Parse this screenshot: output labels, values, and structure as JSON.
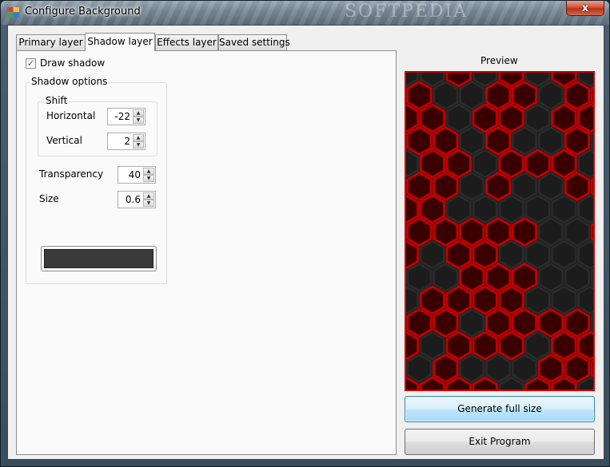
{
  "window": {
    "title": "Configure Background",
    "watermark": "SOFTPEDIA",
    "close_glyph": "x",
    "app_icon": "app-icon-squares"
  },
  "tabs": [
    {
      "label": "Primary layer",
      "active": false
    },
    {
      "label": "Shadow layer",
      "active": true
    },
    {
      "label": "Effects layer",
      "active": false
    },
    {
      "label": "Saved settings",
      "active": false
    }
  ],
  "shadow": {
    "draw_shadow_label": "Draw shadow",
    "draw_shadow_checked": true,
    "check_glyph": "✓",
    "options_group_label": "Shadow options",
    "shift_group_label": "Shift",
    "horizontal_label": "Horizontal",
    "horizontal_value": "-22",
    "vertical_label": "Vertical",
    "vertical_value": "2",
    "transparency_label": "Transparency",
    "transparency_value": "40",
    "size_label": "Size",
    "size_value": "0.6",
    "shadow_color": "#3a3a3a",
    "up_glyph": "▲",
    "down_glyph": "▼"
  },
  "preview": {
    "label": "Preview",
    "border_color": "#d00000",
    "hex_red": "#c00000",
    "hex_dark": "#2a2a2a"
  },
  "buttons": {
    "generate_label": "Generate full size",
    "exit_label": "Exit Program"
  }
}
